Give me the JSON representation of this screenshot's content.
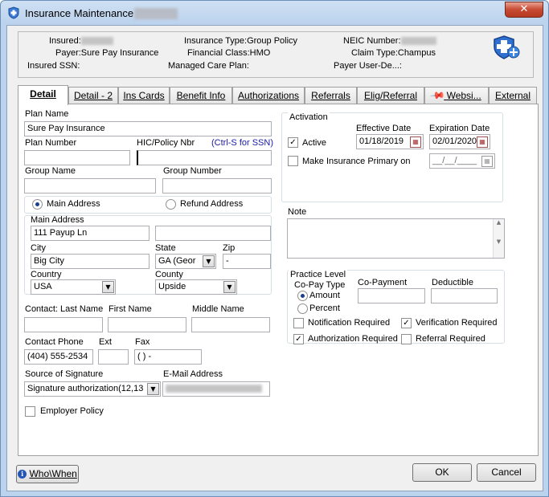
{
  "window": {
    "title": "Insurance Maintenance -",
    "close_glyph": "✕"
  },
  "header": {
    "insured_label": "Insured:",
    "payer": "Payer:Sure Pay Insurance",
    "insured_ssn": "Insured SSN:",
    "insurance_type": "Insurance Type:Group Policy",
    "financial_class": "Financial Class:HMO",
    "managed_care_plan": "Managed Care Plan:",
    "neic_number_label": "NEIC Number:",
    "claim_type": "Claim Type:Champus",
    "payer_user_de": "Payer User-De...:"
  },
  "tabs": [
    "Detail",
    "Detail - 2",
    "Ins Cards",
    "Benefit Info",
    "Authorizations",
    "Referrals",
    "Elig/Referral",
    "Websi...",
    "External"
  ],
  "detail": {
    "plan_name_label": "Plan Name",
    "plan_name_value": "Sure Pay Insurance",
    "plan_number_label": "Plan Number",
    "hic_label": "HIC/Policy Nbr",
    "hic_hint": "(Ctrl-S for SSN)",
    "group_name_label": "Group Name",
    "group_number_label": "Group Number",
    "main_address_radio": "Main Address",
    "refund_address_radio": "Refund Address",
    "main_address_label": "Main Address",
    "address1": "111 Payup Ln",
    "city_label": "City",
    "city_value": "Big City",
    "state_label": "State",
    "state_value": "GA  (Geor",
    "zip_label": "Zip",
    "zip_value": "     -",
    "country_label": "Country",
    "country_value": "USA",
    "county_label": "County",
    "county_value": "Upside",
    "contact_last_label": "Contact: Last Name",
    "first_name_label": "First Name",
    "middle_name_label": "Middle Name",
    "contact_phone_label": "Contact Phone",
    "contact_phone_value": "(404) 555-2534",
    "ext_label": "Ext",
    "fax_label": "Fax",
    "fax_value": "(    )    -",
    "source_sig_label": "Source of Signature",
    "source_sig_value": "Signature authorization(12,13",
    "email_label": "E-Mail Address",
    "employer_policy_label": "Employer Policy"
  },
  "activation": {
    "legend": "Activation",
    "effective_label": "Effective Date",
    "expiration_label": "Expiration Date",
    "active_label": "Active",
    "effective_value": "01/18/2019",
    "expiration_value": "02/01/2020",
    "make_primary_label": "Make Insurance Primary on",
    "primary_date_value": "__/__/____"
  },
  "note": {
    "label": "Note"
  },
  "practice": {
    "legend": "Practice Level",
    "copay_type_label": "Co-Pay Type",
    "amount_label": "Amount",
    "percent_label": "Percent",
    "copayment_label": "Co-Payment",
    "deductible_label": "Deductible",
    "notification_label": "Notification Required",
    "verification_label": "Verification Required",
    "authorization_label": "Authorization Required",
    "referral_label": "Referral Required"
  },
  "footer": {
    "whowhen_label": "Who\\When",
    "ok_label": "OK",
    "cancel_label": "Cancel"
  },
  "colors": {
    "hint_blue": "#1a1aa8",
    "title_bar": "#bcd3ee",
    "close_red": "#c74a33"
  }
}
